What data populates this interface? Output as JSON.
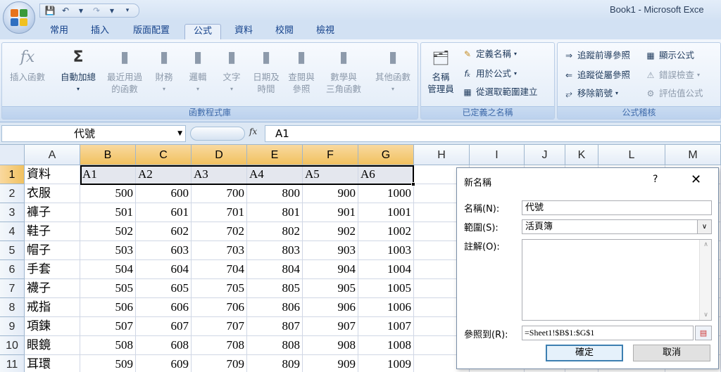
{
  "window": {
    "title": "Book1 - Microsoft Exce"
  },
  "qat": {
    "save_icon": "save-icon",
    "undo_icon": "undo-icon",
    "redo_icon": "redo-icon"
  },
  "tabs": [
    {
      "label": "常用"
    },
    {
      "label": "插入"
    },
    {
      "label": "版面配置"
    },
    {
      "label": "公式"
    },
    {
      "label": "資料"
    },
    {
      "label": "校閱"
    },
    {
      "label": "檢視"
    }
  ],
  "ribbon": {
    "function_library": {
      "label": "函數程式庫",
      "insert_function": "插入函數",
      "autosum": "自動加總",
      "recent_line1": "最近用過",
      "recent_line2": "的函數",
      "financial": "財務",
      "logical": "邏輯",
      "text": "文字",
      "datetime_line1": "日期及",
      "datetime_line2": "時間",
      "lookup_line1": "查閱與",
      "lookup_line2": "參照",
      "math_line1": "數學與",
      "math_line2": "三角函數",
      "more": "其他函數"
    },
    "defined_names": {
      "label": "已定義之名稱",
      "name_manager_line1": "名稱",
      "name_manager_line2": "管理員",
      "define_name": "定義名稱",
      "use_in_formula": "用於公式",
      "create_from_selection": "從選取範圍建立"
    },
    "formula_auditing": {
      "label": "公式稽核",
      "trace_precedents": "追蹤前導參照",
      "trace_dependents": "追蹤從屬參照",
      "remove_arrows": "移除箭號",
      "show_formulas": "顯示公式",
      "error_checking": "錯誤檢查",
      "evaluate_formula": "評估值公式"
    }
  },
  "formula_bar": {
    "name_box": "代號",
    "fx": "fx",
    "content": "A1"
  },
  "columns": [
    "A",
    "B",
    "C",
    "D",
    "E",
    "F",
    "G",
    "H",
    "I",
    "J",
    "K",
    "L",
    "M"
  ],
  "rows": [
    {
      "n": "1",
      "a": "資料",
      "vals": [
        "A1",
        "A2",
        "A3",
        "A4",
        "A5",
        "A6"
      ]
    },
    {
      "n": "2",
      "a": "衣服",
      "vals": [
        "500",
        "600",
        "700",
        "800",
        "900",
        "1000"
      ]
    },
    {
      "n": "3",
      "a": "褲子",
      "vals": [
        "501",
        "601",
        "701",
        "801",
        "901",
        "1001"
      ]
    },
    {
      "n": "4",
      "a": "鞋子",
      "vals": [
        "502",
        "602",
        "702",
        "802",
        "902",
        "1002"
      ]
    },
    {
      "n": "5",
      "a": "帽子",
      "vals": [
        "503",
        "603",
        "703",
        "803",
        "903",
        "1003"
      ]
    },
    {
      "n": "6",
      "a": "手套",
      "vals": [
        "504",
        "604",
        "704",
        "804",
        "904",
        "1004"
      ]
    },
    {
      "n": "7",
      "a": "襪子",
      "vals": [
        "505",
        "605",
        "705",
        "805",
        "905",
        "1005"
      ]
    },
    {
      "n": "8",
      "a": "戒指",
      "vals": [
        "506",
        "606",
        "706",
        "806",
        "906",
        "1006"
      ]
    },
    {
      "n": "9",
      "a": "項鍊",
      "vals": [
        "507",
        "607",
        "707",
        "807",
        "907",
        "1007"
      ]
    },
    {
      "n": "10",
      "a": "眼鏡",
      "vals": [
        "508",
        "608",
        "708",
        "808",
        "908",
        "1008"
      ]
    },
    {
      "n": "11",
      "a": "耳環",
      "vals": [
        "509",
        "609",
        "709",
        "809",
        "909",
        "1009"
      ]
    }
  ],
  "dialog": {
    "title": "新名稱",
    "help": "?",
    "close": "✕",
    "name_label": "名稱(N):",
    "name_value": "代號",
    "scope_label": "範圍(S):",
    "scope_value": "活頁簿",
    "comment_label": "註解(O):",
    "refers_label": "參照到(R):",
    "refers_value": "=Sheet1!$B$1:$G$1",
    "ok": "確定",
    "cancel": "取消"
  },
  "colors": {
    "accent": "#f1c15f",
    "ribbon_text": "#1e395b",
    "group_label": "#3e6aaa"
  }
}
